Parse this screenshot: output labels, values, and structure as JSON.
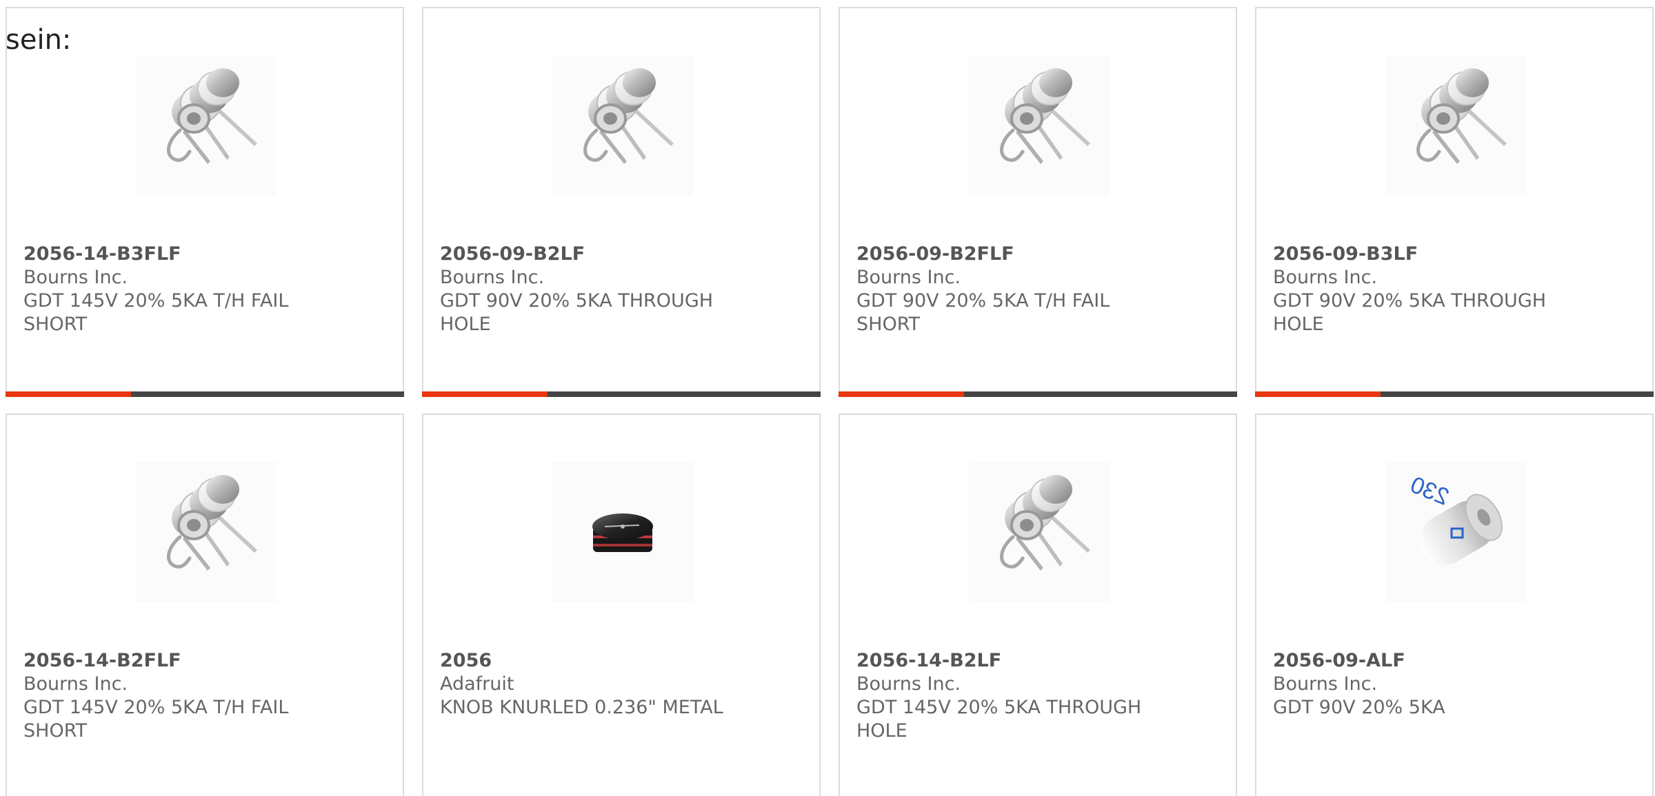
{
  "intro_text": "sein:",
  "accent_color": "#e8350f",
  "bar_color": "#444444",
  "products": [
    {
      "part": "2056-14-B3FLF",
      "manufacturer": "Bourns Inc.",
      "description": "GDT 145V 20% 5KA T/H FAIL SHORT",
      "image": "gas-discharge-tube-3-lead-icon",
      "bar_visible": true
    },
    {
      "part": "2056-09-B2LF",
      "manufacturer": "Bourns Inc.",
      "description": "GDT 90V 20% 5KA THROUGH HOLE",
      "image": "gas-discharge-tube-3-lead-icon",
      "bar_visible": true
    },
    {
      "part": "2056-09-B2FLF",
      "manufacturer": "Bourns Inc.",
      "description": "GDT 90V 20% 5KA T/H FAIL SHORT",
      "image": "gas-discharge-tube-3-lead-icon",
      "bar_visible": true
    },
    {
      "part": "2056-09-B3LF",
      "manufacturer": "Bourns Inc.",
      "description": "GDT 90V 20% 5KA THROUGH HOLE",
      "image": "gas-discharge-tube-3-lead-icon",
      "bar_visible": true
    },
    {
      "part": "2056-14-B2FLF",
      "manufacturer": "Bourns Inc.",
      "description": "GDT 145V 20% 5KA T/H FAIL SHORT",
      "image": "gas-discharge-tube-3-lead-icon",
      "bar_visible": false
    },
    {
      "part": "2056",
      "manufacturer": "Adafruit",
      "description": "KNOB KNURLED 0.236\" METAL",
      "image": "knurled-knob-icon",
      "bar_visible": false
    },
    {
      "part": "2056-14-B2LF",
      "manufacturer": "Bourns Inc.",
      "description": "GDT 145V 20% 5KA THROUGH HOLE",
      "image": "gas-discharge-tube-3-lead-icon",
      "bar_visible": false
    },
    {
      "part": "2056-09-ALF",
      "manufacturer": "Bourns Inc.",
      "description": "GDT 90V 20% 5KA",
      "image": "gas-discharge-tube-cylinder-icon",
      "image_marking": "230",
      "bar_visible": false
    }
  ]
}
